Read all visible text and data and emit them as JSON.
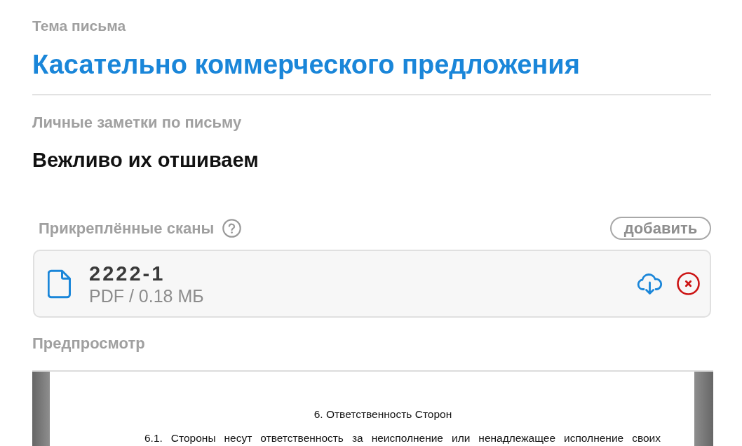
{
  "subject": {
    "label": "Тема письма",
    "value": "Касательно коммерческого предложения"
  },
  "notes": {
    "label": "Личные заметки по письму",
    "value": "Вежливо их отшиваем"
  },
  "attachments": {
    "label": "Прикреплённые сканы",
    "add_button": "добавить",
    "files": [
      {
        "name": "2222-1",
        "meta": "PDF / 0.18 МБ"
      }
    ]
  },
  "preview": {
    "label": "Предпросмотр",
    "document": {
      "heading": "6. Ответственность Сторон",
      "paragraphs": [
        "6.1. Стороны несут ответственность за неисполнение или ненадлежащее исполнение своих"
      ]
    }
  }
}
